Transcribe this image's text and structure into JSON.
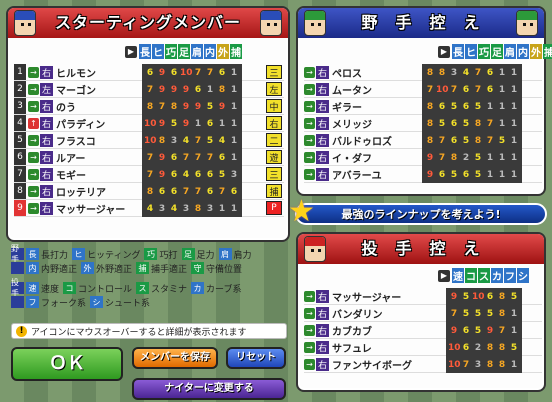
{
  "starting": {
    "title": "スターティングメンバー",
    "columns": [
      "長",
      "ヒ",
      "巧",
      "足",
      "肩",
      "内",
      "外",
      "捕"
    ],
    "column_colors": [
      "#2f74c8",
      "#2f74c8",
      "#1a9a45",
      "#1a9a45",
      "#2f74c8",
      "#2f74c8",
      "#c8a41a",
      "#1a9a45"
    ],
    "rows": [
      {
        "num": "1",
        "arrow": "→",
        "hand": "右",
        "name": "ヒルモン",
        "stats": [
          "6",
          "9",
          "6",
          "10",
          "7",
          "7",
          "6",
          "1"
        ],
        "pos": "三"
      },
      {
        "num": "2",
        "arrow": "→",
        "hand": "左",
        "name": "マーゴン",
        "stats": [
          "7",
          "9",
          "9",
          "9",
          "6",
          "1",
          "8",
          "1"
        ],
        "pos": "左"
      },
      {
        "num": "3",
        "arrow": "→",
        "hand": "右",
        "name": "のう",
        "stats": [
          "8",
          "7",
          "8",
          "9",
          "9",
          "5",
          "9",
          "1"
        ],
        "pos": "中"
      },
      {
        "num": "4",
        "arrow": "↑",
        "hand": "右",
        "name": "パラディン",
        "stats": [
          "10",
          "9",
          "5",
          "9",
          "1",
          "6",
          "1",
          "1"
        ],
        "pos": "右"
      },
      {
        "num": "5",
        "arrow": "→",
        "hand": "右",
        "name": "フラスコ",
        "stats": [
          "10",
          "8",
          "3",
          "4",
          "7",
          "5",
          "4",
          "1"
        ],
        "pos": "二"
      },
      {
        "num": "6",
        "arrow": "→",
        "hand": "右",
        "name": "ルアー",
        "stats": [
          "7",
          "9",
          "6",
          "7",
          "7",
          "7",
          "6",
          "1"
        ],
        "pos": "遊"
      },
      {
        "num": "7",
        "arrow": "→",
        "hand": "右",
        "name": "モギー",
        "stats": [
          "7",
          "9",
          "6",
          "4",
          "6",
          "6",
          "5",
          "3"
        ],
        "pos": "三"
      },
      {
        "num": "8",
        "arrow": "→",
        "hand": "右",
        "name": "ロッテリア",
        "stats": [
          "8",
          "6",
          "6",
          "7",
          "7",
          "6",
          "7",
          "6"
        ],
        "pos": "捕"
      },
      {
        "num": "9",
        "arrow": "→",
        "hand": "右",
        "name": "マッサージャー",
        "stats": [
          "4",
          "3",
          "4",
          "3",
          "8",
          "3",
          "1",
          "1"
        ],
        "pos": "P"
      }
    ],
    "pos_colors": [
      "#f2e02a",
      "#f2e02a",
      "#f2e02a",
      "#f2e02a",
      "#f2e02a",
      "#f2e02a",
      "#f2e02a",
      "#f2e02a",
      "#e22"
    ]
  },
  "legend": {
    "batter_tag": "野手",
    "pitcher_tag": "投手",
    "batter": [
      [
        {
          "k": "長",
          "t": "長打力",
          "c": "#2f74c8"
        },
        {
          "k": "ヒ",
          "t": "ヒッティング",
          "c": "#2f74c8"
        },
        {
          "k": "巧",
          "t": "巧打",
          "c": "#1a9a45"
        },
        {
          "k": "足",
          "t": "足力",
          "c": "#1a9a45"
        },
        {
          "k": "肩",
          "t": "肩力",
          "c": "#2f74c8"
        }
      ],
      [
        {
          "k": "内",
          "t": "内野適正",
          "c": "#2f74c8"
        },
        {
          "k": "外",
          "t": "外野適正",
          "c": "#2f74c8"
        },
        {
          "k": "捕",
          "t": "捕手適正",
          "c": "#1a9a45"
        },
        {
          "k": "守",
          "t": "守備位置",
          "c": "#1a9a45"
        }
      ]
    ],
    "pitcher": [
      [
        {
          "k": "速",
          "t": "速度",
          "c": "#2f74c8"
        },
        {
          "k": "コ",
          "t": "コントロール",
          "c": "#1a9a45"
        },
        {
          "k": "ス",
          "t": "スタミナ",
          "c": "#1a9a45"
        },
        {
          "k": "カ",
          "t": "カーブ系",
          "c": "#2f74c8"
        }
      ],
      [
        {
          "k": "フ",
          "t": "フォーク系",
          "c": "#2f74c8"
        },
        {
          "k": "シ",
          "t": "シュート系",
          "c": "#2f74c8"
        }
      ]
    ]
  },
  "tip": "アイコンにマウスオーバーすると詳細が表示されます",
  "buttons": {
    "ok": "ＯＫ",
    "save": "メンバーを保存",
    "reset": "リセット",
    "night": "ナイターに変更する"
  },
  "bench": {
    "title": "野　手　控　え",
    "columns": [
      "長",
      "ヒ",
      "巧",
      "足",
      "肩",
      "内",
      "外",
      "捕"
    ],
    "rows": [
      {
        "hand": "右",
        "name": "ペロス",
        "stats": [
          "8",
          "8",
          "3",
          "4",
          "7",
          "6",
          "1",
          "1"
        ]
      },
      {
        "hand": "右",
        "name": "ムータン",
        "stats": [
          "7",
          "10",
          "7",
          "6",
          "7",
          "6",
          "1",
          "1"
        ]
      },
      {
        "hand": "右",
        "name": "ギラー",
        "stats": [
          "8",
          "6",
          "5",
          "6",
          "5",
          "1",
          "1",
          "1"
        ]
      },
      {
        "hand": "右",
        "name": "メリッジ",
        "stats": [
          "8",
          "5",
          "6",
          "5",
          "8",
          "7",
          "1",
          "1"
        ]
      },
      {
        "hand": "右",
        "name": "バルドゥロズ",
        "stats": [
          "8",
          "7",
          "6",
          "5",
          "8",
          "7",
          "5",
          "1"
        ]
      },
      {
        "hand": "右",
        "name": "イ・ダフ",
        "stats": [
          "9",
          "7",
          "8",
          "2",
          "5",
          "1",
          "1",
          "1"
        ]
      },
      {
        "hand": "右",
        "name": "アバラーユ",
        "stats": [
          "9",
          "6",
          "5",
          "6",
          "5",
          "1",
          "1",
          "1"
        ]
      }
    ]
  },
  "banner": "最強のラインナップを考えよう!",
  "pitchers": {
    "title": "投　手　控　え",
    "columns": [
      "速",
      "コ",
      "ス",
      "カ",
      "フ",
      "シ"
    ],
    "column_colors": [
      "#2f74c8",
      "#1a9a45",
      "#1a9a45",
      "#2f74c8",
      "#2f74c8",
      "#2f74c8"
    ],
    "rows": [
      {
        "hand": "右",
        "name": "マッサージャー",
        "stats": [
          "9",
          "5",
          "10",
          "6",
          "8",
          "5"
        ]
      },
      {
        "hand": "右",
        "name": "バンダリン",
        "stats": [
          "7",
          "5",
          "5",
          "5",
          "8",
          "1"
        ]
      },
      {
        "hand": "右",
        "name": "カブカブ",
        "stats": [
          "9",
          "6",
          "5",
          "9",
          "7",
          "1"
        ]
      },
      {
        "hand": "右",
        "name": "サフュレ",
        "stats": [
          "10",
          "6",
          "2",
          "8",
          "8",
          "5"
        ]
      },
      {
        "hand": "右",
        "name": "ファンサイボーグ",
        "stats": [
          "10",
          "7",
          "3",
          "8",
          "8",
          "1"
        ]
      }
    ]
  },
  "stat_colors": {
    "high": "#ff5a3a",
    "mid": "#f5a623",
    "low": "#f2e02a",
    "min": "#bbbbbb"
  }
}
